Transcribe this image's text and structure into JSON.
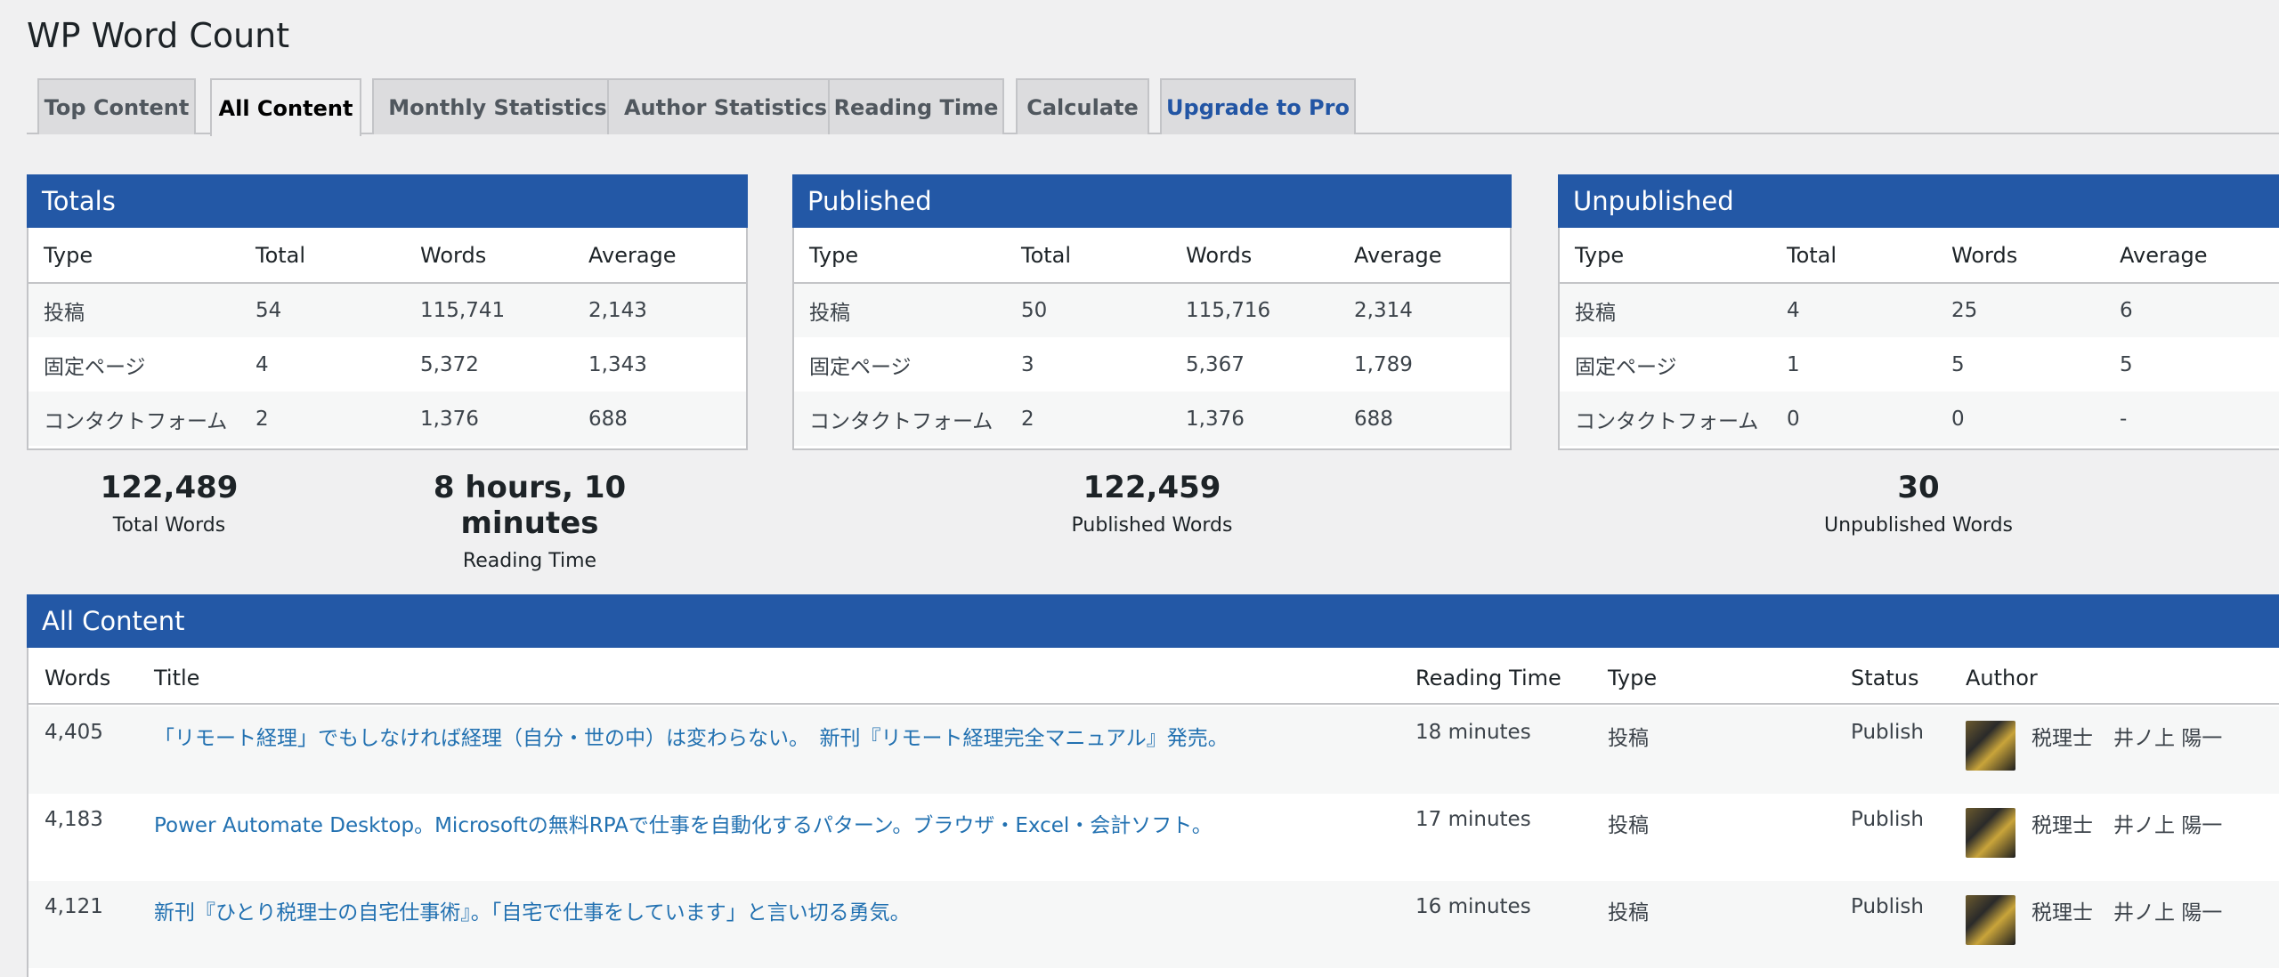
{
  "page": {
    "title": "WP Word Count"
  },
  "tabs": [
    {
      "label": "Top Content"
    },
    {
      "label": "All Content"
    },
    {
      "label": "Monthly Statistics"
    },
    {
      "label": "Author Statistics"
    },
    {
      "label": "Reading Time"
    },
    {
      "label": "Calculate"
    },
    {
      "label": "Upgrade to Pro"
    }
  ],
  "active_tab": "All Content",
  "columns": {
    "type": "Type",
    "total": "Total",
    "words": "Words",
    "average": "Average"
  },
  "panels": {
    "totals": {
      "title": "Totals",
      "rows": [
        {
          "type": "投稿",
          "total": "54",
          "words": "115,741",
          "average": "2,143"
        },
        {
          "type": "固定ページ",
          "total": "4",
          "words": "5,372",
          "average": "1,343"
        },
        {
          "type": "コンタクトフォーム",
          "total": "2",
          "words": "1,376",
          "average": "688"
        }
      ]
    },
    "published": {
      "title": "Published",
      "rows": [
        {
          "type": "投稿",
          "total": "50",
          "words": "115,716",
          "average": "2,314"
        },
        {
          "type": "固定ページ",
          "total": "3",
          "words": "5,367",
          "average": "1,789"
        },
        {
          "type": "コンタクトフォーム",
          "total": "2",
          "words": "1,376",
          "average": "688"
        }
      ]
    },
    "unpublished": {
      "title": "Unpublished",
      "rows": [
        {
          "type": "投稿",
          "total": "4",
          "words": "25",
          "average": "6"
        },
        {
          "type": "固定ページ",
          "total": "1",
          "words": "5",
          "average": "5"
        },
        {
          "type": "コンタクトフォーム",
          "total": "0",
          "words": "0",
          "average": "-"
        }
      ]
    }
  },
  "summary": {
    "total_words": {
      "value": "122,489",
      "label": "Total Words"
    },
    "reading_time": {
      "value": "8 hours, 10 minutes",
      "label": "Reading Time"
    },
    "published_words": {
      "value": "122,459",
      "label": "Published Words"
    },
    "unpublished_words": {
      "value": "30",
      "label": "Unpublished Words"
    }
  },
  "all_content": {
    "title": "All Content",
    "headers": {
      "words": "Words",
      "title": "Title",
      "reading_time": "Reading Time",
      "type": "Type",
      "status": "Status",
      "author": "Author"
    },
    "rows": [
      {
        "words": "4,405",
        "title": "「リモート経理」でもしなければ経理（自分・世の中）は変わらない。　新刊『リモート経理完全マニュアル』発売。",
        "reading_time": "18 minutes",
        "type": "投稿",
        "status": "Publish",
        "author": "税理士　井ノ上 陽一"
      },
      {
        "words": "4,183",
        "title": "Power Automate Desktop。Microsoftの無料RPAで仕事を自動化するパターン。ブラウザ・Excel・会計ソフト。",
        "reading_time": "17 minutes",
        "type": "投稿",
        "status": "Publish",
        "author": "税理士　井ノ上 陽一"
      },
      {
        "words": "4,121",
        "title": "新刊『ひとり税理士の自宅仕事術』。「自宅で仕事をしています」と言い切る勇気。",
        "reading_time": "16 minutes",
        "type": "投稿",
        "status": "Publish",
        "author": "税理士　井ノ上 陽一"
      }
    ]
  },
  "colors": {
    "header_blue": "#2358a6",
    "link": "#2271b1",
    "background": "#f0f0f1"
  }
}
